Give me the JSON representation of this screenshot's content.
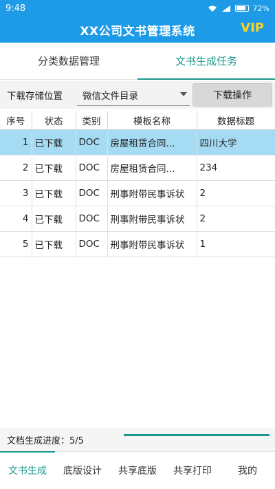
{
  "statusbar": {
    "time": "9:48",
    "battery": "72%"
  },
  "app": {
    "title": "XX公司文书管理系统",
    "vip": "VIP"
  },
  "tabs": [
    {
      "label": "分类数据管理",
      "active": false
    },
    {
      "label": "文书生成任务",
      "active": true
    }
  ],
  "storage": {
    "label": "下载存储位置",
    "selected": "微信文件目录",
    "action": "下载操作"
  },
  "table": {
    "headers": [
      "序号",
      "状态",
      "类别",
      "模板名称",
      "数据标题"
    ],
    "rows": [
      [
        "1",
        "已下载",
        "DOC",
        "房屋租赁合同...",
        "四川大学"
      ],
      [
        "2",
        "已下载",
        "DOC",
        "房屋租赁合同...",
        "234"
      ],
      [
        "3",
        "已下载",
        "DOC",
        "刑事附带民事诉状",
        "2"
      ],
      [
        "4",
        "已下载",
        "DOC",
        "刑事附带民事诉状",
        "2"
      ],
      [
        "5",
        "已下载",
        "DOC",
        "刑事附带民事诉状",
        "1"
      ]
    ],
    "selected_row": 0
  },
  "progress": {
    "label": "文档生成进度：5/5",
    "fraction": 1.0
  },
  "bottomnav": [
    {
      "label": "文书生成",
      "active": true
    },
    {
      "label": "底版设计",
      "active": false
    },
    {
      "label": "共享底版",
      "active": false
    },
    {
      "label": "共享打印",
      "active": false
    },
    {
      "label": "我的",
      "active": false
    }
  ],
  "colors": {
    "primary": "#1e9be6",
    "accent": "#1a9a8a",
    "vip": "#ffd21e",
    "selected_row": "#a6dcf3"
  },
  "icons": [
    "wifi-icon",
    "signal-icon",
    "battery-icon"
  ]
}
